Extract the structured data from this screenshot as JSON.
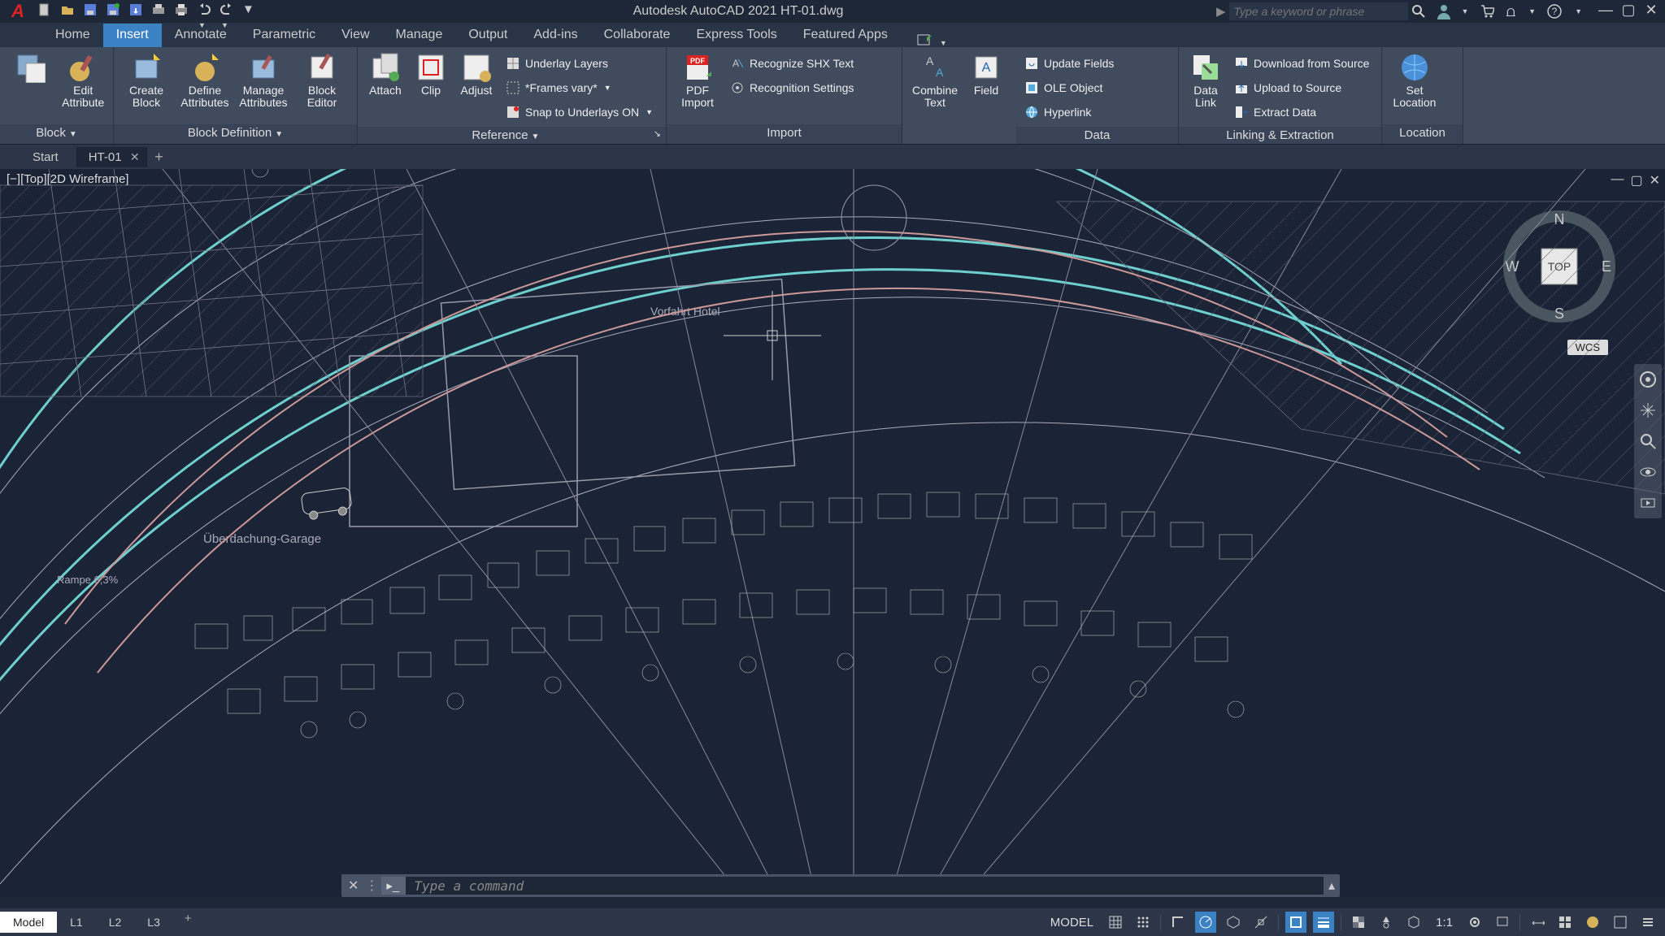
{
  "title": "Autodesk AutoCAD 2021   HT-01.dwg",
  "search_placeholder": "Type a keyword or phrase",
  "logo_text": "A",
  "ribbon_tabs": [
    "Home",
    "Insert",
    "Annotate",
    "Parametric",
    "View",
    "Manage",
    "Output",
    "Add-ins",
    "Collaborate",
    "Express Tools",
    "Featured Apps"
  ],
  "active_ribbon_tab": "Insert",
  "panels": {
    "block": {
      "title": "Block",
      "buttons": {
        "edit_attr": "Edit\nAttribute"
      }
    },
    "blockdef": {
      "title": "Block Definition",
      "buttons": {
        "create": "Create\nBlock",
        "define": "Define\nAttributes",
        "manage": "Manage\nAttributes",
        "editor": "Block\nEditor"
      }
    },
    "reference": {
      "title": "Reference",
      "buttons": {
        "attach": "Attach",
        "clip": "Clip",
        "adjust": "Adjust"
      },
      "rows": {
        "underlay": "Underlay Layers",
        "frames": "*Frames vary*",
        "snap": "Snap to Underlays ON"
      }
    },
    "import": {
      "title": "Import",
      "buttons": {
        "pdf": "PDF\nImport"
      },
      "rows": {
        "shx": "Recognize SHX Text",
        "recog": "Recognition Settings"
      }
    },
    "combine": {
      "buttons": {
        "combine": "Combine\nText",
        "field": "Field"
      }
    },
    "data": {
      "title": "Data",
      "buttons": {
        "datalink": "Data\nLink"
      },
      "rows": {
        "update": "Update Fields",
        "ole": "OLE Object",
        "hyper": "Hyperlink"
      }
    },
    "linking": {
      "title": "Linking & Extraction",
      "rows": {
        "download": "Download from Source",
        "upload": "Upload to Source",
        "extract": "Extract  Data"
      }
    },
    "location": {
      "title": "Location",
      "buttons": {
        "set": "Set\nLocation"
      }
    }
  },
  "file_tabs": {
    "start": "Start",
    "ht": "HT-01"
  },
  "viewport_label": "[−][Top][2D Wireframe]",
  "navcube": {
    "top": "TOP",
    "n": "N",
    "s": "S",
    "e": "E",
    "w": "W"
  },
  "wcs": "WCS",
  "cmd_placeholder": "Type a command",
  "status": {
    "model": "Model",
    "l1": "L1",
    "l2": "L2",
    "l3": "L3",
    "model_right": "MODEL",
    "scale": "1:1"
  },
  "drawing_annotations": {
    "uberdachung": "Überdachung-Garage",
    "rampe": "Rampe 6,3%",
    "vorfahrt": "Vorfahrt Hotel"
  }
}
